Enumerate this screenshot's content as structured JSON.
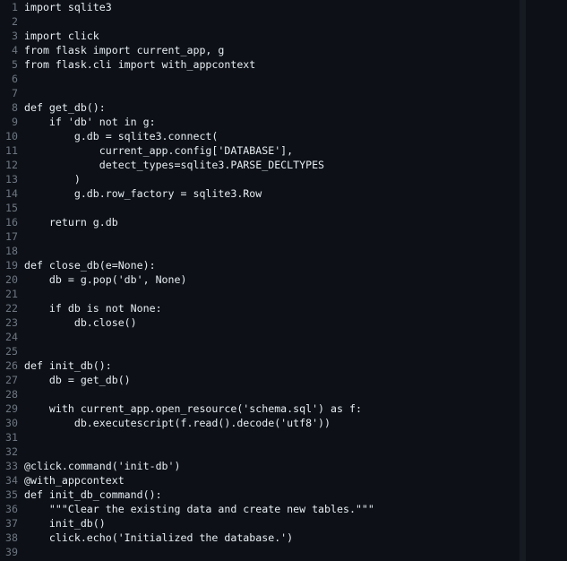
{
  "editor": {
    "lines": [
      {
        "n": "1",
        "text": "import sqlite3"
      },
      {
        "n": "2",
        "text": ""
      },
      {
        "n": "3",
        "text": "import click"
      },
      {
        "n": "4",
        "text": "from flask import current_app, g"
      },
      {
        "n": "5",
        "text": "from flask.cli import with_appcontext"
      },
      {
        "n": "6",
        "text": ""
      },
      {
        "n": "7",
        "text": ""
      },
      {
        "n": "8",
        "text": "def get_db():"
      },
      {
        "n": "9",
        "text": "    if 'db' not in g:"
      },
      {
        "n": "10",
        "text": "        g.db = sqlite3.connect("
      },
      {
        "n": "11",
        "text": "            current_app.config['DATABASE'],"
      },
      {
        "n": "12",
        "text": "            detect_types=sqlite3.PARSE_DECLTYPES"
      },
      {
        "n": "13",
        "text": "        )"
      },
      {
        "n": "14",
        "text": "        g.db.row_factory = sqlite3.Row"
      },
      {
        "n": "15",
        "text": ""
      },
      {
        "n": "16",
        "text": "    return g.db"
      },
      {
        "n": "17",
        "text": ""
      },
      {
        "n": "18",
        "text": ""
      },
      {
        "n": "19",
        "text": "def close_db(e=None):"
      },
      {
        "n": "20",
        "text": "    db = g.pop('db', None)"
      },
      {
        "n": "21",
        "text": ""
      },
      {
        "n": "22",
        "text": "    if db is not None:"
      },
      {
        "n": "23",
        "text": "        db.close()"
      },
      {
        "n": "24",
        "text": ""
      },
      {
        "n": "25",
        "text": ""
      },
      {
        "n": "26",
        "text": "def init_db():"
      },
      {
        "n": "27",
        "text": "    db = get_db()"
      },
      {
        "n": "28",
        "text": ""
      },
      {
        "n": "29",
        "text": "    with current_app.open_resource('schema.sql') as f:"
      },
      {
        "n": "30",
        "text": "        db.executescript(f.read().decode('utf8'))"
      },
      {
        "n": "31",
        "text": ""
      },
      {
        "n": "32",
        "text": ""
      },
      {
        "n": "33",
        "text": "@click.command('init-db')"
      },
      {
        "n": "34",
        "text": "@with_appcontext"
      },
      {
        "n": "35",
        "text": "def init_db_command():"
      },
      {
        "n": "36",
        "text": "    \"\"\"Clear the existing data and create new tables.\"\"\""
      },
      {
        "n": "37",
        "text": "    init_db()"
      },
      {
        "n": "38",
        "text": "    click.echo('Initialized the database.')"
      },
      {
        "n": "39",
        "text": ""
      }
    ]
  }
}
